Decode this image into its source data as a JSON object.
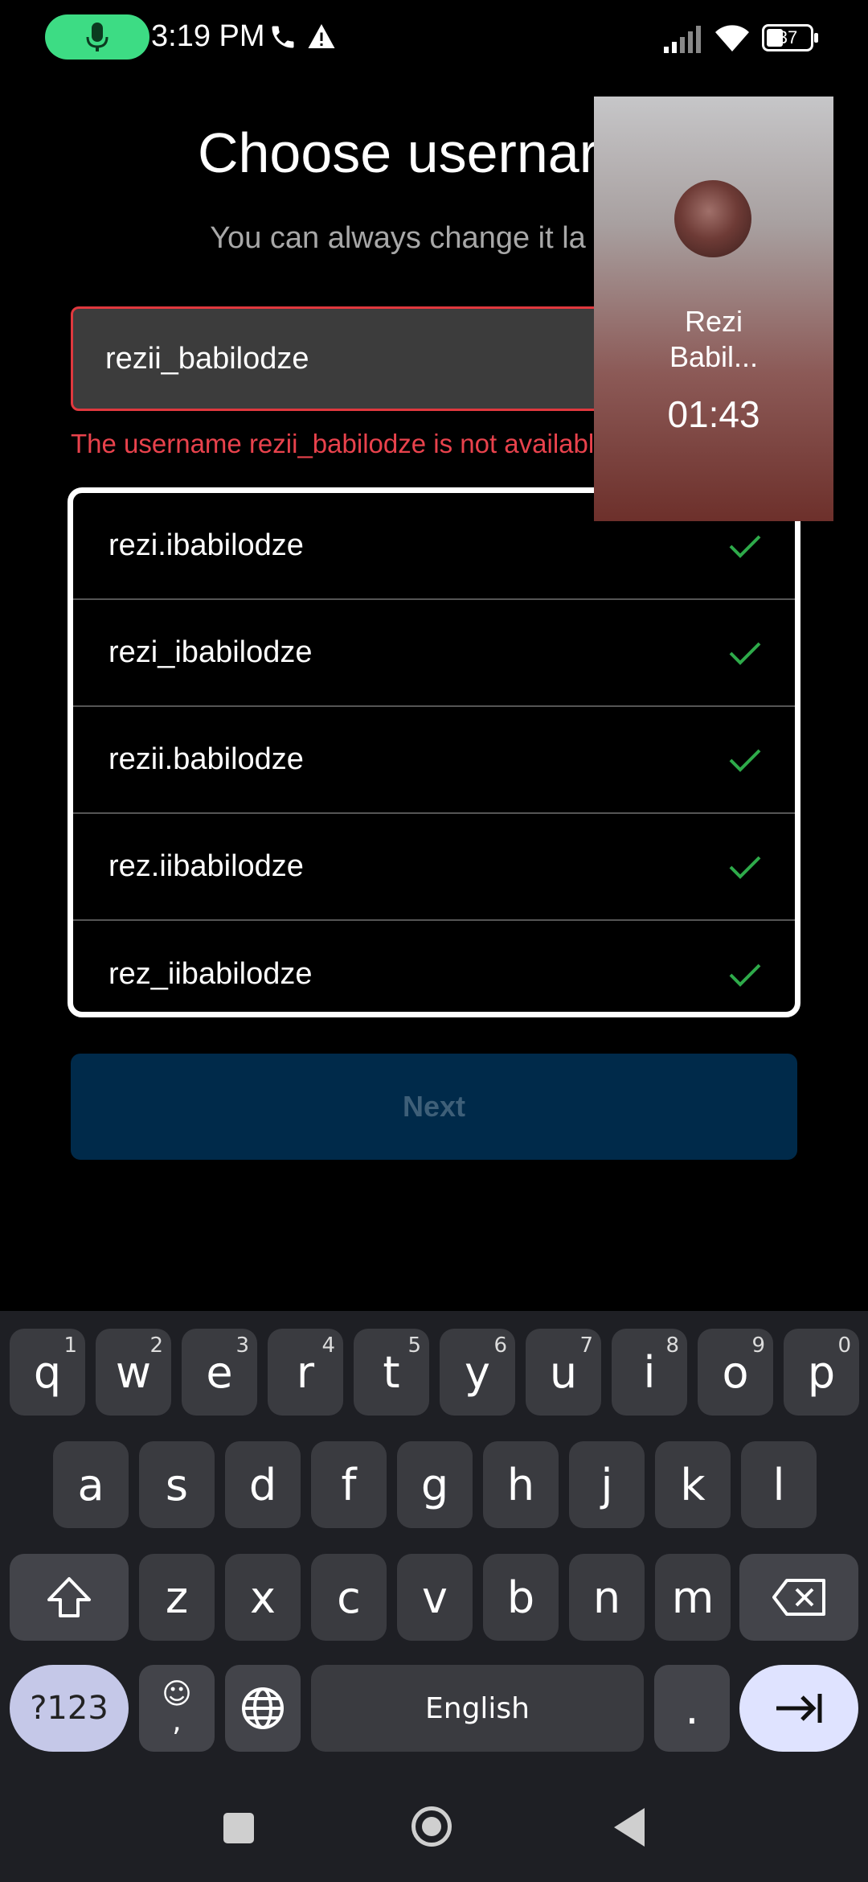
{
  "status_bar": {
    "time": "3:19 PM",
    "battery": "37"
  },
  "header": {
    "title": "Choose usernar",
    "subtitle": "You can always change it la"
  },
  "username_input": {
    "value": "rezii_babilodze"
  },
  "error_message": "The username rezii_babilodze is not availabl",
  "suggestions": [
    "rezi.ibabilodze",
    "rezi_ibabilodze",
    "rezii.babilodze",
    "rez.iibabilodze",
    "rez_iibabilodze"
  ],
  "next_button": {
    "label": "Next"
  },
  "call_overlay": {
    "caller_name_line1": "Rezi",
    "caller_name_line2": "Babil...",
    "timer": "01:43"
  },
  "keyboard": {
    "row1": [
      [
        "q",
        "1"
      ],
      [
        "w",
        "2"
      ],
      [
        "e",
        "3"
      ],
      [
        "r",
        "4"
      ],
      [
        "t",
        "5"
      ],
      [
        "y",
        "6"
      ],
      [
        "u",
        "7"
      ],
      [
        "i",
        "8"
      ],
      [
        "o",
        "9"
      ],
      [
        "p",
        "0"
      ]
    ],
    "row2": [
      "a",
      "s",
      "d",
      "f",
      "g",
      "h",
      "j",
      "k",
      "l"
    ],
    "row3": [
      "z",
      "x",
      "c",
      "v",
      "b",
      "n",
      "m"
    ],
    "symbols_label": "?123",
    "emoji_comma_top": "☺",
    "comma_label": ",",
    "space_label": "English",
    "period_label": "."
  },
  "colors": {
    "accent_green": "#3ddc84",
    "error_red": "#e8424c",
    "next_bg": "#002a4a",
    "keyboard_bg": "#1e1f24"
  }
}
